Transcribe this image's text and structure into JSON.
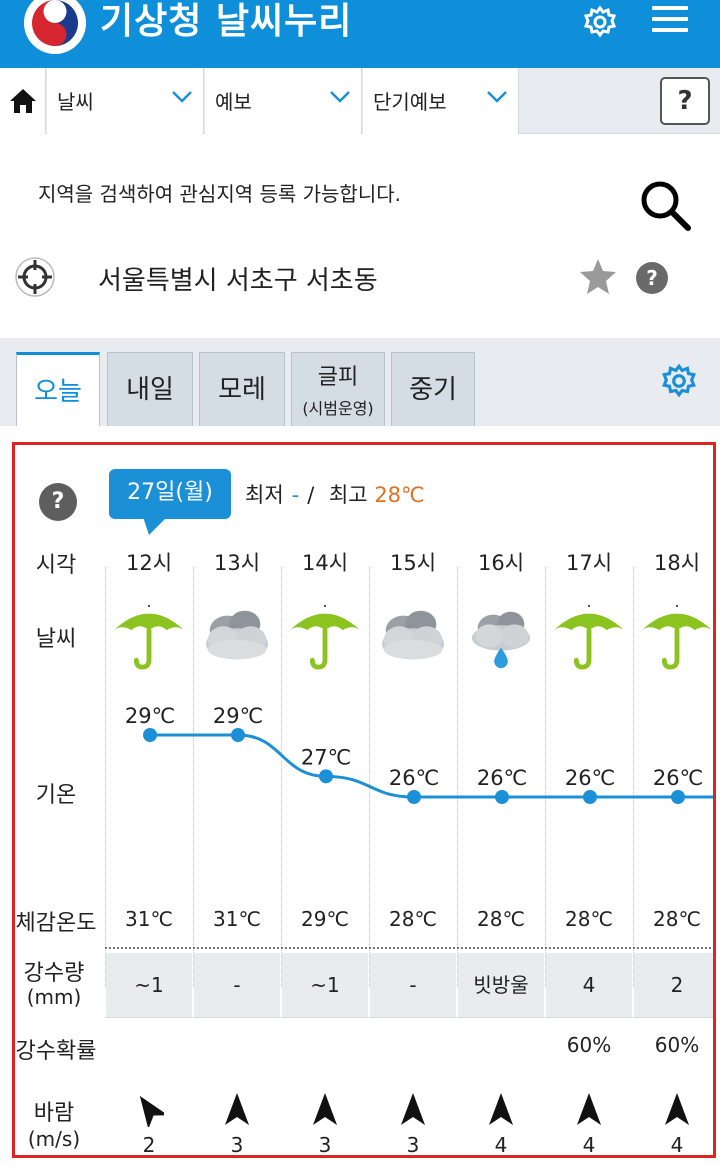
{
  "header": {
    "title": "기상청 날씨누리",
    "logo_icon": "kma-taegeuk-logo",
    "settings_icon": "gear-icon",
    "menu_icon": "hamburger-menu-icon",
    "brand_color": "#0f8fd9"
  },
  "nav": {
    "home_icon": "home-icon",
    "selects": [
      "날씨",
      "예보",
      "단기예보"
    ],
    "help_label": "?"
  },
  "search": {
    "hint": "지역을 검색하여 관심지역 등록 가능합니다.",
    "location": "서울특별시 서초구 서초동",
    "help_label": "?"
  },
  "tabs": [
    {
      "label": "오늘",
      "active": true
    },
    {
      "label": "내일",
      "active": false
    },
    {
      "label": "모레",
      "active": false
    },
    {
      "label": "글피",
      "sub": "(시범운영)",
      "active": false
    },
    {
      "label": "중기",
      "active": false
    }
  ],
  "forecast": {
    "help_label": "?",
    "date": "27일(월)",
    "min_label": "최저",
    "min_value": "-",
    "separator": "/",
    "max_label": "최고",
    "max_value": "28℃",
    "row_labels": {
      "hour": "시각",
      "weather": "날씨",
      "temp": "기온",
      "feel": "체감온도",
      "rain": "강수량",
      "rain_unit": "(mm)",
      "prob": "강수확률",
      "wind": "바람",
      "wind_unit": "(m/s)"
    },
    "columns": [
      {
        "hour": "12시",
        "weather": "umbrella-rain-icon",
        "temp": "29℃",
        "temp_value": 29,
        "feel": "31℃",
        "rain": "~1",
        "prob": "",
        "wind_dir": "northwest",
        "wind_speed": "2"
      },
      {
        "hour": "13시",
        "weather": "cloudy-icon",
        "temp": "29℃",
        "temp_value": 29,
        "feel": "31℃",
        "rain": "-",
        "prob": "",
        "wind_dir": "north",
        "wind_speed": "3"
      },
      {
        "hour": "14시",
        "weather": "umbrella-rain-icon",
        "temp": "27℃",
        "temp_value": 27,
        "feel": "29℃",
        "rain": "~1",
        "prob": "",
        "wind_dir": "north",
        "wind_speed": "3"
      },
      {
        "hour": "15시",
        "weather": "cloudy-icon",
        "temp": "26℃",
        "temp_value": 26,
        "feel": "28℃",
        "rain": "-",
        "prob": "",
        "wind_dir": "north",
        "wind_speed": "3"
      },
      {
        "hour": "16시",
        "weather": "cloud-raindrop-icon",
        "temp": "26℃",
        "temp_value": 26,
        "feel": "28℃",
        "rain": "빗방울",
        "prob": "",
        "wind_dir": "north",
        "wind_speed": "4"
      },
      {
        "hour": "17시",
        "weather": "umbrella-rain-icon",
        "temp": "26℃",
        "temp_value": 26,
        "feel": "28℃",
        "rain": "4",
        "prob": "60%",
        "wind_dir": "north",
        "wind_speed": "4"
      },
      {
        "hour": "18시",
        "weather": "umbrella-rain-icon",
        "temp": "26℃",
        "temp_value": 26,
        "feel": "28℃",
        "rain": "2",
        "prob": "60%",
        "wind_dir": "north",
        "wind_speed": "4"
      }
    ],
    "line_color": "#1c90d6"
  }
}
